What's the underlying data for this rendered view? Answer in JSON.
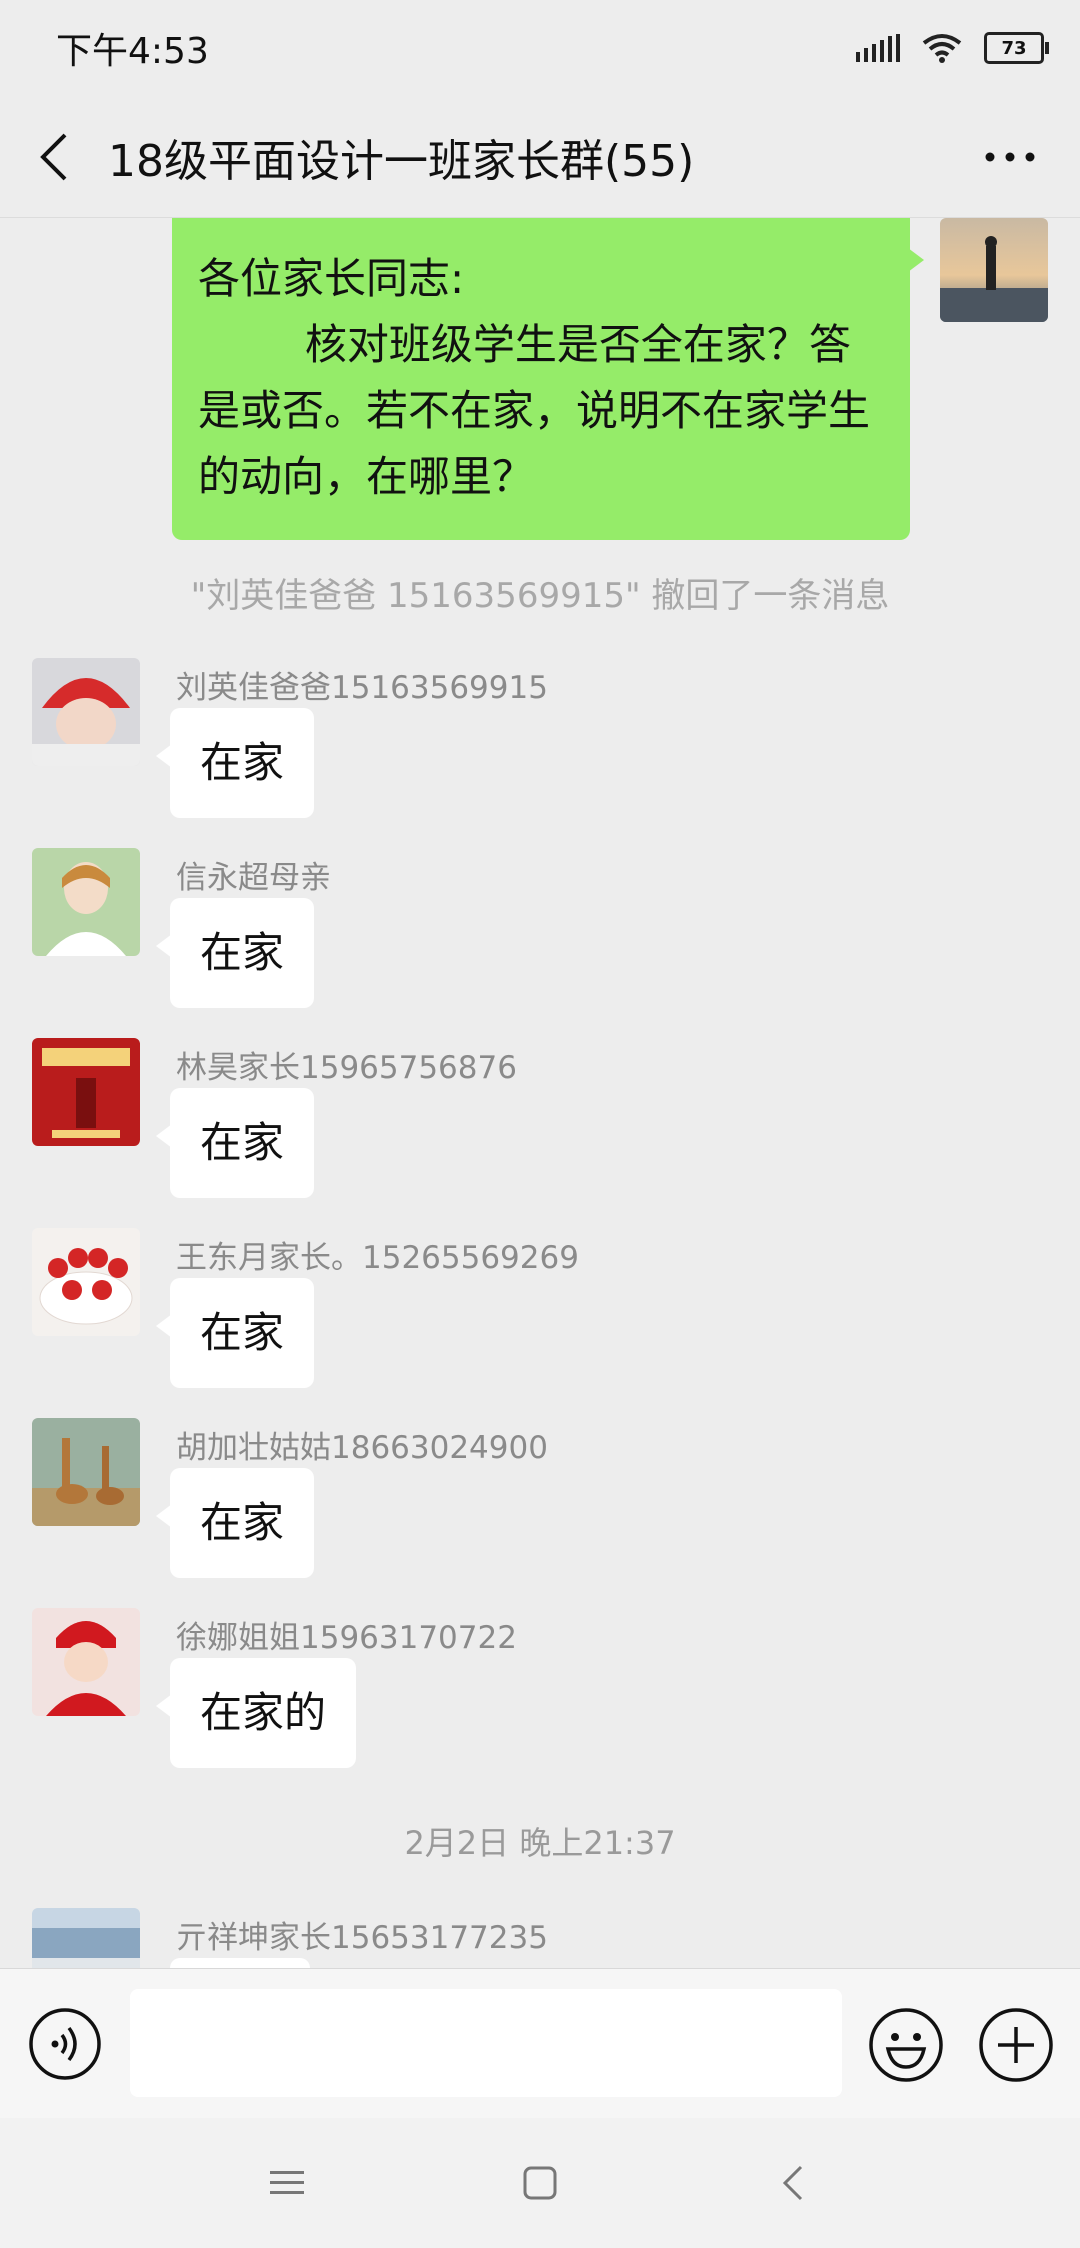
{
  "status_bar": {
    "time": "下午4:53",
    "battery": "73"
  },
  "header": {
    "title": "18级平面设计一班家长群(55)"
  },
  "my_message": {
    "text": "各位家长同志:\n        核对班级学生是否全在家？答是或否。若不在家，说明不在家学生的动向，在哪里？"
  },
  "recall_notice": "\"刘英佳爸爸 15163569915\" 撤回了一条消息",
  "messages": [
    {
      "sender": "刘英佳爸爸15163569915",
      "text": "在家",
      "avatar": "baby-red-hat"
    },
    {
      "sender": "信永超母亲",
      "text": "在家",
      "avatar": "woman-portrait"
    },
    {
      "sender": "林昊家长15965756876",
      "text": "在家",
      "avatar": "red-ad-poster"
    },
    {
      "sender": "王东月家长。15265569269",
      "text": "在家",
      "avatar": "strawberry-cake"
    },
    {
      "sender": "胡加壮姑姑18663024900",
      "text": "在家",
      "avatar": "giraffes"
    },
    {
      "sender": "徐娜姐姐15963170722",
      "text": "在家的",
      "avatar": "child-red-costume"
    }
  ],
  "time_divider": "2月2日 晚上21:37",
  "partial_message": {
    "sender": "亓祥坤家长15653177235",
    "avatar": "building-photo"
  },
  "input": {
    "placeholder": ""
  },
  "icons": {
    "back": "back-arrow-icon",
    "more": "more-dots-icon",
    "voice": "voice-icon",
    "emoji": "emoji-icon",
    "plus": "plus-icon"
  },
  "colors": {
    "my_bubble": "#95ec69",
    "background": "#ededed"
  }
}
